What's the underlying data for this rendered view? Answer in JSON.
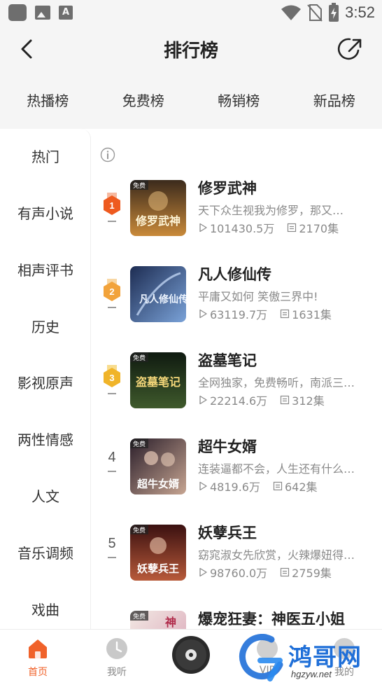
{
  "status_bar": {
    "time": "3:52"
  },
  "header": {
    "title": "排行榜"
  },
  "tabs": [
    {
      "label": "热播榜"
    },
    {
      "label": "免费榜"
    },
    {
      "label": "畅销榜"
    },
    {
      "label": "新品榜"
    }
  ],
  "sidebar": {
    "items": [
      {
        "label": "热门"
      },
      {
        "label": "有声小说"
      },
      {
        "label": "相声评书"
      },
      {
        "label": "历史"
      },
      {
        "label": "影视原声"
      },
      {
        "label": "两性情感"
      },
      {
        "label": "人文"
      },
      {
        "label": "音乐调频"
      },
      {
        "label": "戏曲"
      }
    ]
  },
  "books": [
    {
      "rank": "1",
      "title": "修罗武神",
      "desc": "天下众生视我为修罗，那又…",
      "plays": "101430.5万",
      "episodes": "2170集",
      "cover_tag": "免费",
      "cover_text": "修罗武神",
      "cover_colors": [
        "#3b2a1c",
        "#c98a3a"
      ]
    },
    {
      "rank": "2",
      "title": "凡人修仙传",
      "desc": "平庸又如何 笑傲三界中!",
      "plays": "63119.7万",
      "episodes": "1631集",
      "cover_tag": "",
      "cover_text": "凡人修仙传",
      "cover_colors": [
        "#1d2c52",
        "#7aa2d8"
      ]
    },
    {
      "rank": "3",
      "title": "盗墓笔记",
      "desc": "全网独家，免费畅听，南派三…",
      "plays": "22214.6万",
      "episodes": "312集",
      "cover_tag": "免费",
      "cover_text": "盗墓笔记",
      "cover_colors": [
        "#0f1a10",
        "#3f5a2c"
      ]
    },
    {
      "rank": "4",
      "title": "超牛女婿",
      "desc": "连装逼都不会，人生还有什么…",
      "plays": "4819.6万",
      "episodes": "642集",
      "cover_tag": "免费",
      "cover_text": "超牛女婿",
      "cover_colors": [
        "#2a1e2a",
        "#c7a592"
      ]
    },
    {
      "rank": "5",
      "title": "妖孽兵王",
      "desc": "窈窕淑女先欣赏，火辣爆妞得…",
      "plays": "98760.0万",
      "episodes": "2759集",
      "cover_tag": "免费",
      "cover_text": "妖孽兵王",
      "cover_colors": [
        "#3a1010",
        "#b85a3a"
      ]
    },
    {
      "rank": "",
      "title": "爆宠狂妻：神医五小姐",
      "desc": "",
      "plays": "",
      "episodes": "",
      "cover_tag": "免费",
      "cover_text": "神",
      "cover_colors": [
        "#f2e9e4",
        "#d9a2b5"
      ]
    }
  ],
  "bottom_nav": {
    "items": [
      {
        "label": "首页"
      },
      {
        "label": "我听"
      },
      {
        "label": "VIP"
      },
      {
        "label": "我的"
      }
    ]
  },
  "watermark": {
    "text": "鸿哥网",
    "url": "hgzyw.net"
  },
  "colors": {
    "accent": "#f0622a",
    "badge_gold": "#f2a93b",
    "gray_text": "#8a8a8a"
  }
}
